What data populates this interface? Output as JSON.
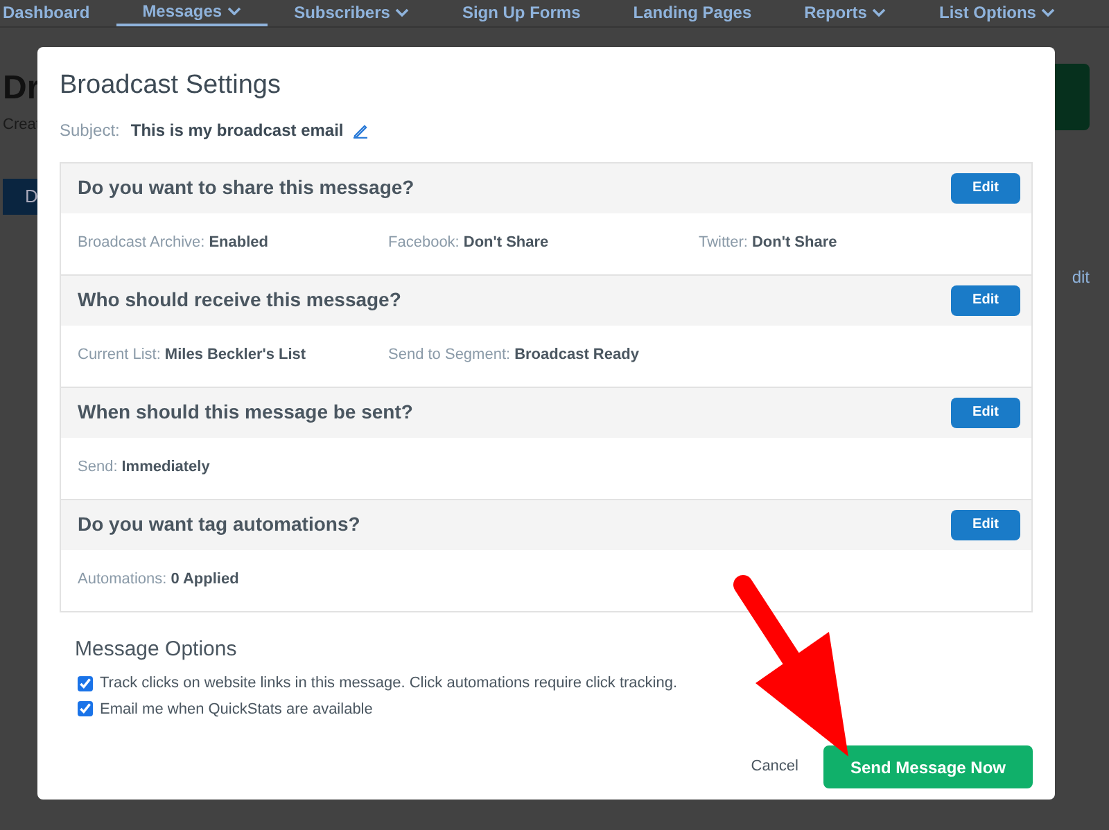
{
  "nav": [
    {
      "label": "Dashboard",
      "dropdown": false,
      "selected": false
    },
    {
      "label": "Messages",
      "dropdown": true,
      "selected": true
    },
    {
      "label": "Subscribers",
      "dropdown": true,
      "selected": false
    },
    {
      "label": "Sign Up Forms",
      "dropdown": false,
      "selected": false
    },
    {
      "label": "Landing Pages",
      "dropdown": false,
      "selected": false
    },
    {
      "label": "Reports",
      "dropdown": true,
      "selected": false
    },
    {
      "label": "List Options",
      "dropdown": true,
      "selected": false
    }
  ],
  "page": {
    "heading": "Dr",
    "subtitle": "Creat",
    "button": "D",
    "link": "dit"
  },
  "modal": {
    "title": "Broadcast Settings",
    "subject_label": "Subject:",
    "subject": "This is my broadcast email",
    "sections": [
      {
        "question": "Do you want to share this message?",
        "edit": "Edit",
        "fields": [
          {
            "label": "Broadcast Archive:",
            "value": "Enabled"
          },
          {
            "label": "Facebook:",
            "value": "Don't Share"
          },
          {
            "label": "Twitter:",
            "value": "Don't Share"
          }
        ]
      },
      {
        "question": "Who should receive this message?",
        "edit": "Edit",
        "fields": [
          {
            "label": "Current List:",
            "value": "Miles Beckler's List"
          },
          {
            "label": "Send to Segment:",
            "value": "Broadcast Ready"
          }
        ]
      },
      {
        "question": "When should this message be sent?",
        "edit": "Edit",
        "fields": [
          {
            "label": "Send:",
            "value": "Immediately"
          }
        ]
      },
      {
        "question": "Do you want tag automations?",
        "edit": "Edit",
        "fields": [
          {
            "label": "Automations:",
            "value": "0 Applied"
          }
        ]
      }
    ],
    "options_title": "Message Options",
    "options": [
      {
        "label": "Track clicks on website links in this message. Click automations require click tracking.",
        "checked": true
      },
      {
        "label": "Email me when QuickStats are available",
        "checked": true
      }
    ],
    "cancel": "Cancel",
    "send": "Send Message Now"
  }
}
